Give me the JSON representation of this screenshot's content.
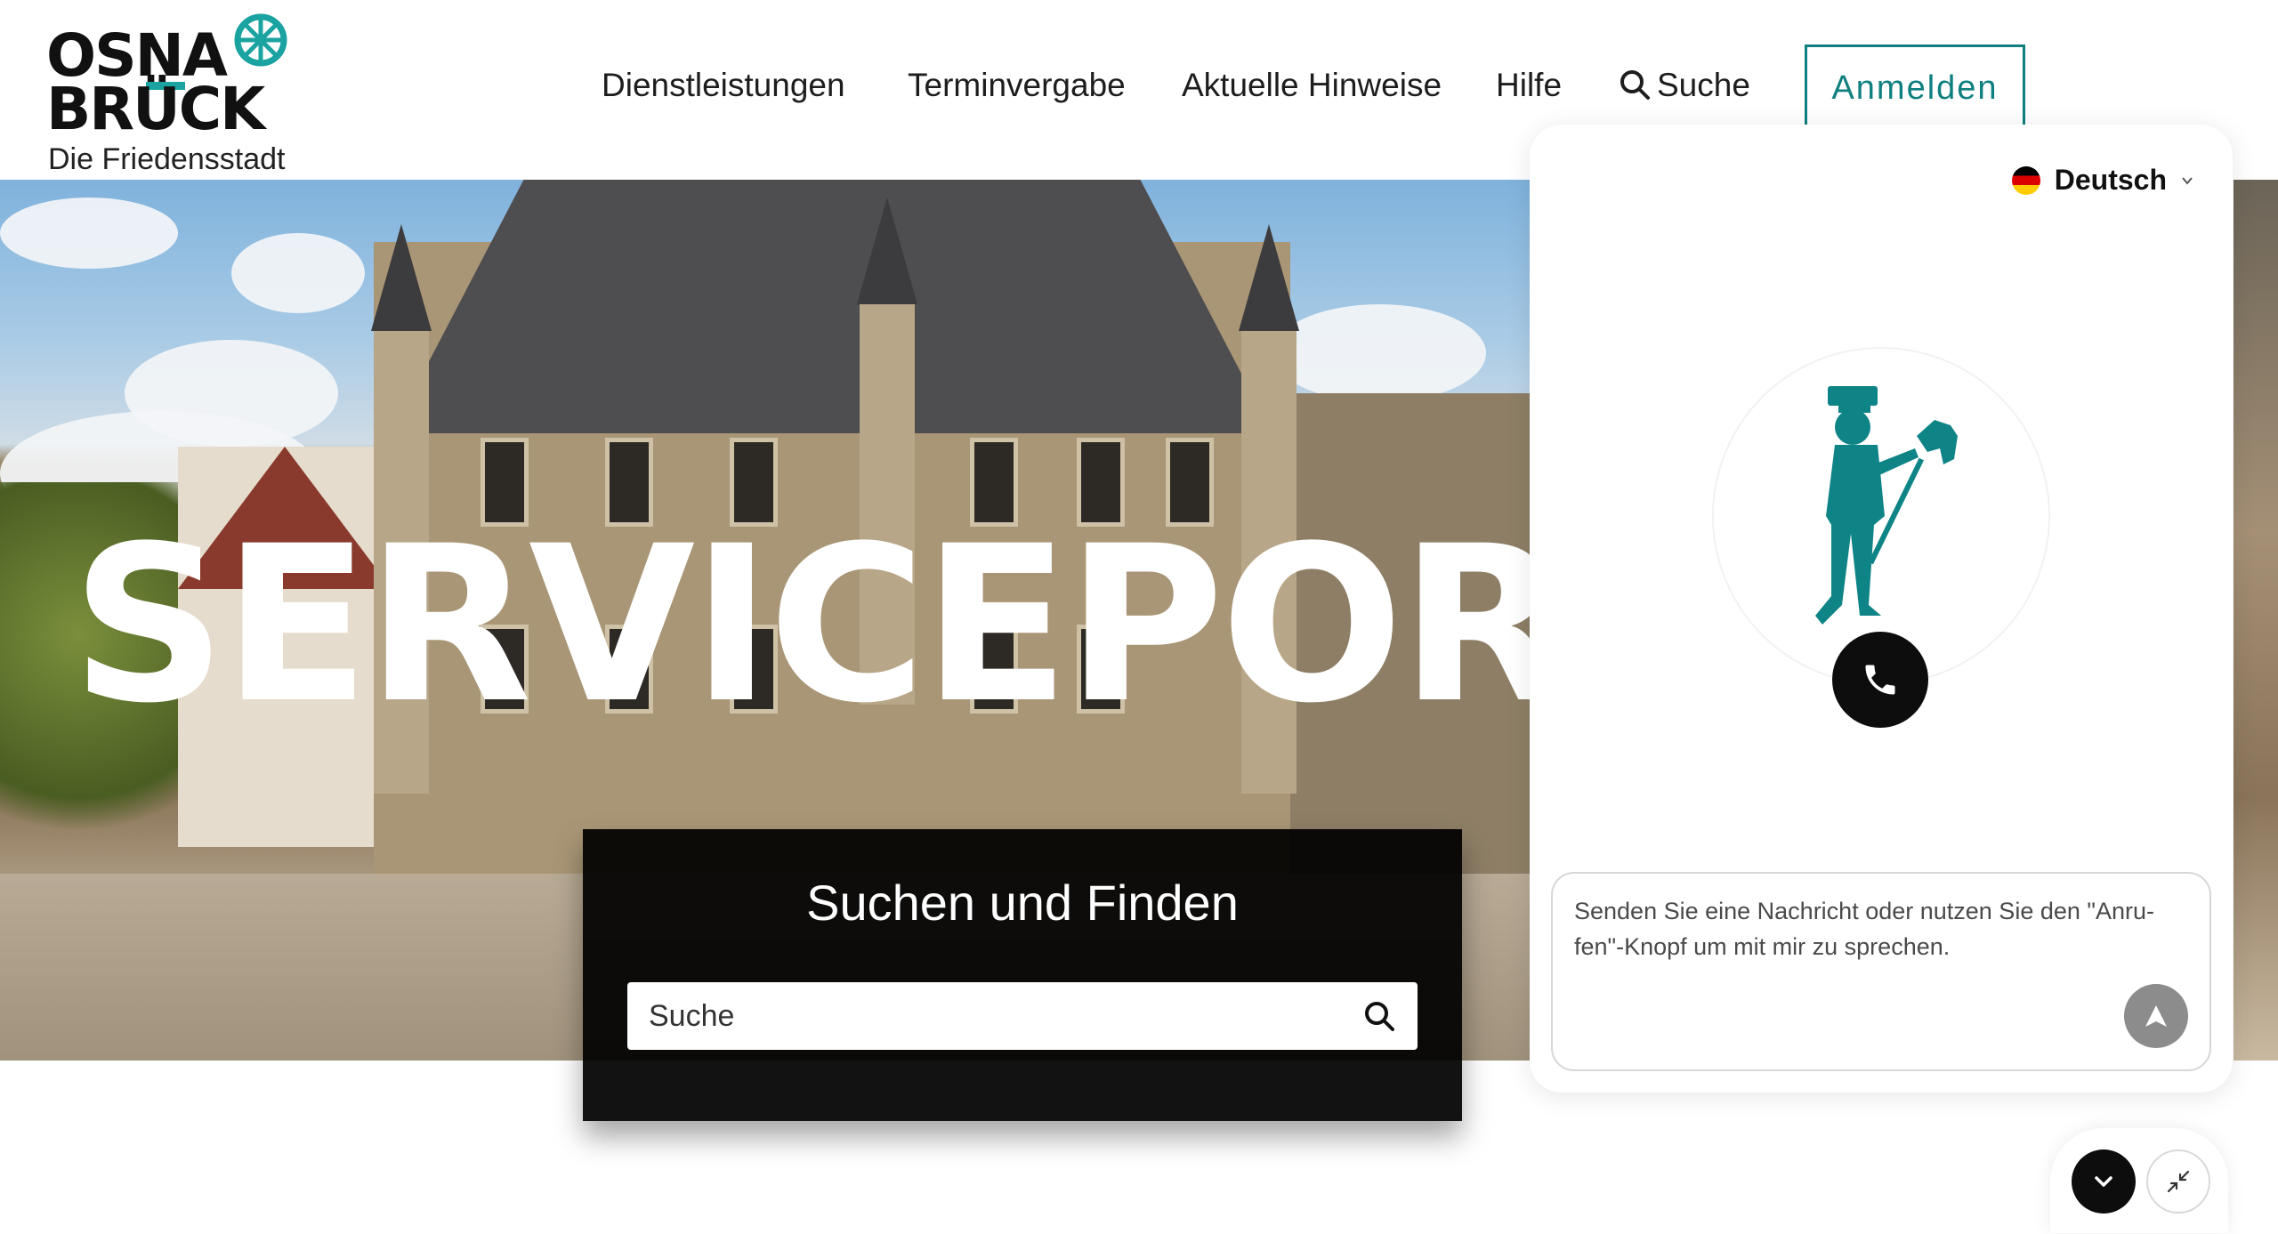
{
  "header": {
    "logo": {
      "line1": "OSNA",
      "line2": "BRÜCK",
      "subtitle": "Die Friedensstadt"
    },
    "nav": [
      {
        "label": "Dienstleistungen"
      },
      {
        "label": "Terminvergabe"
      },
      {
        "label": "Aktuelle Hinweise"
      },
      {
        "label": "Hilfe"
      },
      {
        "label": "Suche",
        "icon": "search-icon"
      }
    ],
    "login_label": "Anmelden"
  },
  "hero": {
    "title": "SERVICEPOR",
    "search": {
      "heading": "Suchen und Finden",
      "placeholder": "Suche",
      "icon": "search-icon"
    }
  },
  "chat": {
    "language": "Deutsch",
    "avatar_icon": "hobby-horse-rider-icon",
    "call_icon": "phone-icon",
    "message_placeholder": "Senden Sie eine Nachricht oder nutzen Sie den \"Anru-fen\"-Knopf um mit mir zu sprechen.",
    "send_icon": "send-icon"
  },
  "controls": {
    "collapse_icon": "chevron-down-icon",
    "minimize_icon": "minimize-arrows-icon"
  },
  "colors": {
    "accent": "#0f7f80",
    "logo_teal": "#1aa3a0",
    "search_panel": "#000000"
  }
}
